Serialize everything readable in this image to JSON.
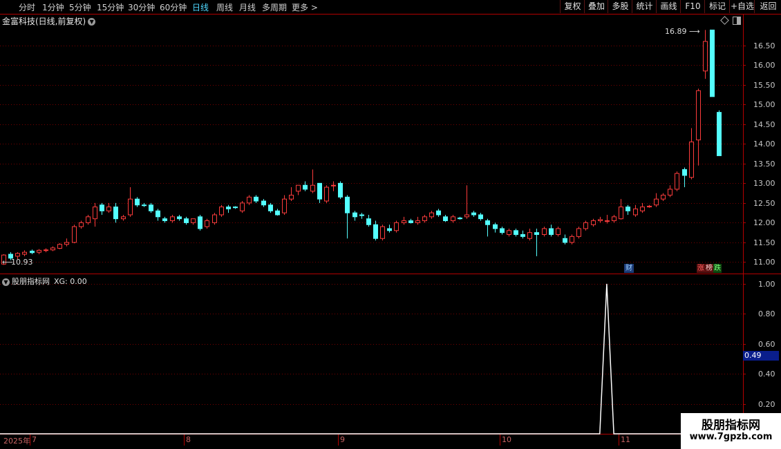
{
  "toolbar": {
    "periods": [
      "分时",
      "1分钟",
      "5分钟",
      "15分钟",
      "30分钟",
      "60分钟",
      "日线",
      "周线",
      "月线",
      "多周期",
      "更多 >"
    ],
    "active_period": "日线",
    "buttons": [
      "复权",
      "叠加",
      "多股",
      "统计",
      "画线",
      "F10",
      "标记",
      "+自选",
      "返回"
    ]
  },
  "stock": {
    "title": "金富科技(日线,前复权)"
  },
  "indicator": {
    "name": "股朋指标网",
    "value_label": "XG: 0.00"
  },
  "colors": {
    "up": "#ff3c3c",
    "down": "#54ffff",
    "grid": "#7a0000",
    "border": "#b40000",
    "line": "#ffffff",
    "accent": "#4fd8ff"
  },
  "chart_data": [
    {
      "type": "candlestick",
      "title": "金富科技(日线,前复权)",
      "y_ticks": [
        "16.50",
        "16.00",
        "15.50",
        "15.00",
        "14.50",
        "14.00",
        "13.50",
        "13.00",
        "12.50",
        "12.00",
        "11.50",
        "11.00"
      ],
      "ylim": [
        10.78,
        16.95
      ],
      "x_ticks": [
        {
          "label": "2025年",
          "index": 0
        },
        {
          "label": "7",
          "index": 4
        },
        {
          "label": "8",
          "index": 26
        },
        {
          "label": "9",
          "index": 48
        },
        {
          "label": "10",
          "index": 71
        },
        {
          "label": "11",
          "index": 88
        }
      ],
      "annotations": {
        "high": "16.89",
        "low": "10.93",
        "finance": "财",
        "limit_up": "涨",
        "ranking": "榜",
        "limit_down": "跌"
      },
      "candles": [
        [
          10.95,
          11.2,
          10.93,
          11.18
        ],
        [
          11.2,
          11.25,
          11.05,
          11.1
        ],
        [
          11.15,
          11.25,
          11.08,
          11.22
        ],
        [
          11.2,
          11.3,
          11.15,
          11.25
        ],
        [
          11.28,
          11.32,
          11.2,
          11.24
        ],
        [
          11.25,
          11.33,
          11.2,
          11.3
        ],
        [
          11.3,
          11.35,
          11.25,
          11.31
        ],
        [
          11.31,
          11.4,
          11.28,
          11.36
        ],
        [
          11.35,
          11.48,
          11.33,
          11.45
        ],
        [
          11.45,
          11.6,
          11.4,
          11.5
        ],
        [
          11.5,
          11.95,
          11.48,
          11.9
        ],
        [
          11.9,
          12.05,
          11.85,
          12.0
        ],
        [
          12.0,
          12.2,
          11.95,
          12.15
        ],
        [
          12.1,
          12.5,
          11.9,
          12.4
        ],
        [
          12.45,
          12.5,
          12.2,
          12.3
        ],
        [
          12.3,
          12.5,
          12.25,
          12.4
        ],
        [
          12.4,
          12.5,
          12.0,
          12.1
        ],
        [
          12.1,
          12.2,
          12.05,
          12.15
        ],
        [
          12.2,
          12.9,
          12.15,
          12.6
        ],
        [
          12.6,
          12.65,
          12.4,
          12.45
        ],
        [
          12.45,
          12.5,
          12.4,
          12.44
        ],
        [
          12.45,
          12.5,
          12.25,
          12.3
        ],
        [
          12.3,
          12.35,
          12.05,
          12.15
        ],
        [
          12.1,
          12.15,
          12.0,
          12.05
        ],
        [
          12.05,
          12.2,
          12.0,
          12.15
        ],
        [
          12.15,
          12.2,
          12.05,
          12.1
        ],
        [
          12.1,
          12.15,
          11.95,
          12.0
        ],
        [
          12.0,
          12.1,
          11.95,
          12.1
        ],
        [
          12.15,
          12.2,
          11.8,
          11.85
        ],
        [
          11.9,
          12.1,
          11.85,
          12.05
        ],
        [
          12.0,
          12.25,
          11.95,
          12.2
        ],
        [
          12.2,
          12.45,
          12.15,
          12.4
        ],
        [
          12.4,
          12.45,
          12.25,
          12.35
        ],
        [
          12.4,
          12.42,
          12.35,
          12.38
        ],
        [
          12.3,
          12.55,
          12.25,
          12.5
        ],
        [
          12.5,
          12.7,
          12.45,
          12.65
        ],
        [
          12.65,
          12.7,
          12.5,
          12.55
        ],
        [
          12.55,
          12.6,
          12.4,
          12.45
        ],
        [
          12.45,
          12.5,
          12.25,
          12.3
        ],
        [
          12.3,
          12.35,
          12.18,
          12.2
        ],
        [
          12.25,
          12.7,
          12.2,
          12.6
        ],
        [
          12.6,
          12.9,
          12.55,
          12.7
        ],
        [
          12.8,
          12.95,
          12.7,
          12.95
        ],
        [
          12.95,
          13.05,
          12.8,
          12.85
        ],
        [
          12.8,
          13.35,
          12.75,
          12.95
        ],
        [
          13.0,
          13.0,
          12.5,
          12.6
        ],
        [
          12.55,
          12.95,
          12.5,
          12.9
        ],
        [
          12.95,
          13.05,
          12.8,
          12.95
        ],
        [
          13.0,
          13.05,
          12.6,
          12.65
        ],
        [
          12.65,
          12.7,
          11.6,
          12.25
        ],
        [
          12.25,
          12.3,
          12.05,
          12.15
        ],
        [
          12.2,
          12.25,
          12.1,
          12.18
        ],
        [
          12.1,
          12.2,
          11.9,
          11.95
        ],
        [
          11.95,
          12.05,
          11.55,
          11.6
        ],
        [
          11.6,
          11.95,
          11.55,
          11.9
        ],
        [
          11.85,
          11.95,
          11.75,
          11.8
        ],
        [
          11.8,
          12.05,
          11.75,
          12.0
        ],
        [
          12.0,
          12.15,
          11.95,
          12.05
        ],
        [
          12.05,
          12.1,
          11.98,
          12.0
        ],
        [
          12.0,
          12.15,
          11.95,
          12.05
        ],
        [
          12.05,
          12.2,
          12.0,
          12.15
        ],
        [
          12.15,
          12.3,
          12.1,
          12.25
        ],
        [
          12.3,
          12.35,
          12.15,
          12.2
        ],
        [
          12.15,
          12.2,
          12.02,
          12.05
        ],
        [
          12.05,
          12.2,
          12.0,
          12.15
        ],
        [
          12.12,
          12.15,
          12.08,
          12.1
        ],
        [
          12.15,
          12.95,
          12.1,
          12.2
        ],
        [
          12.25,
          12.3,
          12.15,
          12.2
        ],
        [
          12.2,
          12.25,
          12.05,
          12.1
        ],
        [
          12.05,
          12.1,
          11.65,
          11.95
        ],
        [
          11.95,
          12.0,
          11.75,
          11.85
        ],
        [
          11.85,
          11.9,
          11.7,
          11.75
        ],
        [
          11.7,
          11.85,
          11.65,
          11.8
        ],
        [
          11.8,
          11.85,
          11.65,
          11.7
        ],
        [
          11.7,
          11.8,
          11.6,
          11.65
        ],
        [
          11.6,
          11.85,
          11.55,
          11.75
        ],
        [
          11.75,
          11.85,
          11.15,
          11.7
        ],
        [
          11.7,
          11.9,
          11.65,
          11.85
        ],
        [
          11.85,
          11.95,
          11.65,
          11.7
        ],
        [
          11.7,
          11.9,
          11.65,
          11.85
        ],
        [
          11.6,
          11.7,
          11.45,
          11.5
        ],
        [
          11.5,
          11.7,
          11.45,
          11.65
        ],
        [
          11.65,
          11.9,
          11.6,
          11.85
        ],
        [
          11.85,
          12.05,
          11.8,
          12.0
        ],
        [
          11.95,
          12.1,
          11.9,
          12.05
        ],
        [
          12.05,
          12.15,
          12.0,
          12.08
        ],
        [
          12.05,
          12.2,
          11.98,
          12.05
        ],
        [
          12.05,
          12.2,
          12.0,
          12.15
        ],
        [
          12.1,
          12.6,
          12.08,
          12.4
        ],
        [
          12.4,
          12.45,
          12.2,
          12.3
        ],
        [
          12.2,
          12.45,
          12.15,
          12.35
        ],
        [
          12.3,
          12.5,
          12.25,
          12.4
        ],
        [
          12.4,
          12.45,
          12.38,
          12.42
        ],
        [
          12.45,
          12.75,
          12.4,
          12.6
        ],
        [
          12.6,
          12.75,
          12.55,
          12.7
        ],
        [
          12.7,
          12.95,
          12.65,
          12.85
        ],
        [
          12.85,
          13.3,
          12.8,
          13.25
        ],
        [
          13.35,
          13.4,
          12.9,
          13.2
        ],
        [
          13.15,
          14.4,
          13.1,
          14.05
        ],
        [
          14.1,
          15.4,
          13.45,
          15.35
        ],
        [
          15.85,
          16.89,
          15.65,
          16.6
        ],
        [
          16.89,
          16.89,
          15.2,
          15.2
        ],
        [
          14.8,
          14.85,
          13.7,
          13.7
        ]
      ]
    },
    {
      "type": "line",
      "title": "股朋指标网",
      "series": [
        {
          "name": "XG",
          "values": [
            0,
            0,
            0,
            0,
            0,
            0,
            0,
            0,
            0,
            0,
            0,
            0,
            0,
            0,
            0,
            0,
            0,
            0,
            0,
            0,
            0,
            0,
            0,
            0,
            0,
            0,
            0,
            0,
            0,
            0,
            0,
            0,
            0,
            0,
            0,
            0,
            0,
            0,
            0,
            0,
            0,
            0,
            0,
            0,
            0,
            0,
            0,
            0,
            0,
            0,
            0,
            0,
            0,
            0,
            0,
            0,
            0,
            0,
            0,
            0,
            0,
            0,
            0,
            0,
            0,
            0,
            0,
            0,
            0,
            0,
            0,
            0,
            0,
            0,
            0,
            0,
            0,
            0,
            0,
            0,
            0,
            0,
            0,
            0,
            0,
            0,
            1,
            0,
            0,
            0,
            0,
            0,
            0,
            0,
            0,
            0,
            0,
            0,
            0,
            0,
            0,
            0,
            0
          ]
        }
      ],
      "y_ticks": [
        "1.00",
        "0.80",
        "0.60",
        "0.40",
        "0.20"
      ],
      "ylim": [
        0.0,
        1.05
      ],
      "cursor_value": "0.49"
    }
  ],
  "watermark": {
    "title": "股朋指标网",
    "url": "www.7gpzb.com"
  }
}
